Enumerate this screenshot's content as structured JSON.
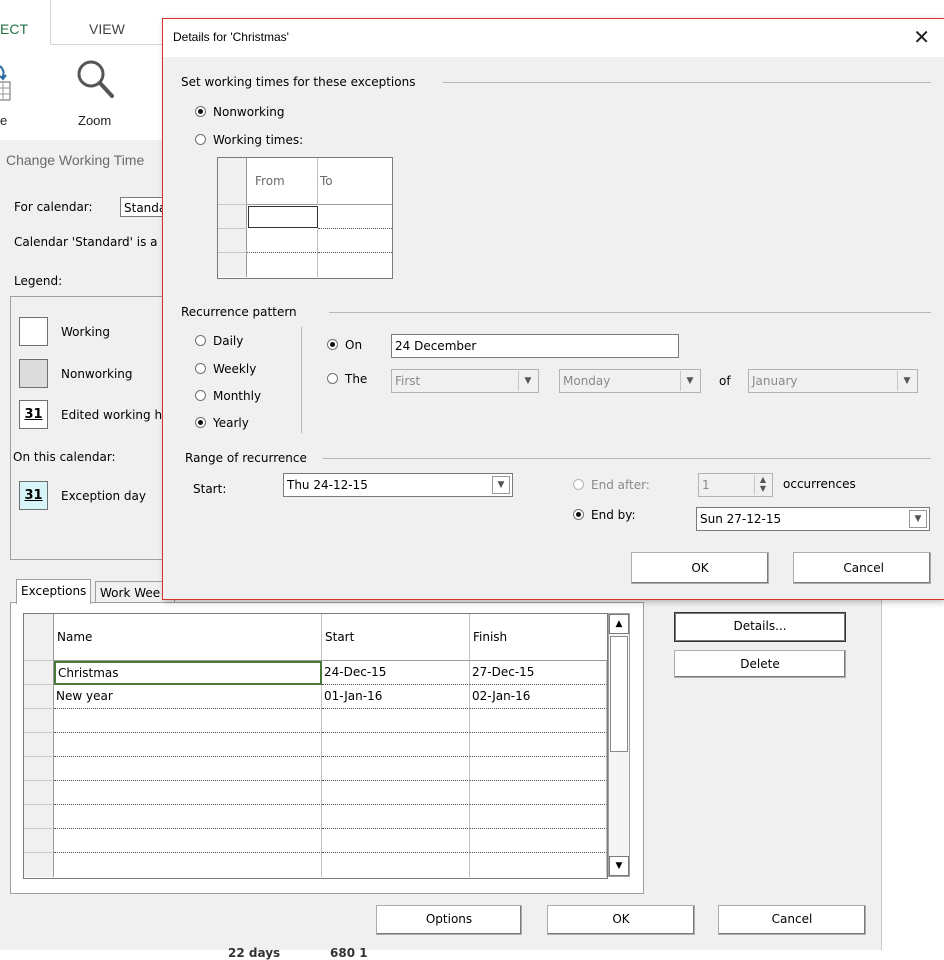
{
  "ribbon": {
    "tabs": [
      {
        "label": "ECT",
        "active": true
      },
      {
        "label": "VIEW",
        "active": false
      }
    ],
    "buttons": [
      {
        "label": "e",
        "icon": "calendar-arrow-icon"
      },
      {
        "label": "Zoom",
        "icon": "magnifier-icon"
      }
    ]
  },
  "cwt": {
    "title": "Change Working Time",
    "for_calendar_label": "For calendar:",
    "for_calendar_value": "Standa",
    "calendar_note": "Calendar 'Standard' is a",
    "legend_label": "Legend:",
    "legend": [
      {
        "label": "Working",
        "swatch": ""
      },
      {
        "label": "Nonworking",
        "swatch": ""
      },
      {
        "label": "Edited working h",
        "swatch": "31"
      }
    ],
    "on_this_calendar": "On this calendar:",
    "exception_day": {
      "label": "Exception day",
      "swatch": "31"
    },
    "tabs": [
      "Exceptions",
      "Work Wee"
    ],
    "table": {
      "columns": [
        "Name",
        "Start",
        "Finish"
      ],
      "rows": [
        [
          "Christmas",
          "24-Dec-15",
          "27-Dec-15"
        ],
        [
          "New year",
          "01-Jan-16",
          "02-Jan-16"
        ]
      ],
      "empty_rows": 7
    },
    "buttons": {
      "details": "Details...",
      "delete": "Delete",
      "options": "Options",
      "ok": "OK",
      "cancel": "Cancel"
    },
    "footer_text_1": "22 days",
    "footer_text_2": "680 1"
  },
  "dialog": {
    "title": "Details for 'Christmas'",
    "close_glyph": "✕",
    "working_section": "Set working times for these exceptions",
    "working_options": [
      {
        "label": "Nonworking",
        "selected": true
      },
      {
        "label": "Working times:",
        "selected": false
      }
    ],
    "time_grid": {
      "columns": [
        "From",
        "To"
      ],
      "rows": 3
    },
    "recurrence_section": "Recurrence pattern",
    "recurrence_options": [
      {
        "label": "Daily",
        "selected": false
      },
      {
        "label": "Weekly",
        "selected": false
      },
      {
        "label": "Monthly",
        "selected": false
      },
      {
        "label": "Yearly",
        "selected": true
      }
    ],
    "yearly": {
      "on_label": "On",
      "on_value": "24 December",
      "the_label": "The",
      "ordinal": "First",
      "weekday": "Monday",
      "of_label": "of",
      "month": "January"
    },
    "range_section": "Range of recurrence",
    "start_label": "Start:",
    "start_value": "Thu 24-12-15",
    "end_after_label": "End after:",
    "end_after_value": "1",
    "occurrences_label": "occurrences",
    "end_by_label": "End by:",
    "end_by_value": "Sun 27-12-15",
    "ok": "OK",
    "cancel": "Cancel"
  },
  "colors": {
    "active_tab": "#217346",
    "dialog_border": "#d3342b",
    "exception_swatch": "#d7f4f8",
    "nonworking_swatch": "#dcdcdc",
    "focus_cell": "#4a7a3a"
  }
}
